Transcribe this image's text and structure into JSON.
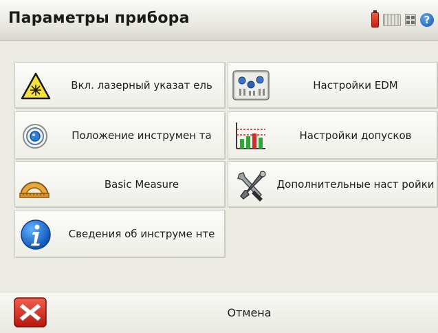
{
  "window": {
    "title": "Параметры прибора"
  },
  "status_icons": [
    "battery-icon",
    "keyboard-icon",
    "grid-icon",
    "help-icon"
  ],
  "status_help_glyph": "?",
  "menu": {
    "laser": "Вкл. лазерный указат ель",
    "instrument_position": "Положение инструмен та",
    "basic_measure": "Basic Measure",
    "instrument_info": "Сведения об инструме нте",
    "edm_settings": "Настройки EDM",
    "tolerance_settings": "Настройки допусков",
    "additional_settings": "Дополнительные наст ройки"
  },
  "cancel": {
    "label": "Отмена"
  },
  "colors": {
    "background": "#ecebe3",
    "laser_yellow": "#f7e23a",
    "info_blue": "#1f6fd0",
    "cancel_red": "#d8261c"
  }
}
